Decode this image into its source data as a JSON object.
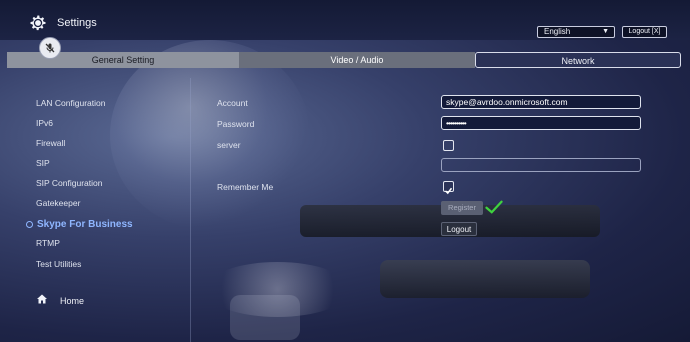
{
  "header": {
    "title": "Settings",
    "language_selected": "English",
    "logout_label": "Logout [X]"
  },
  "tabs": [
    {
      "label": "General Setting"
    },
    {
      "label": "Video / Audio"
    },
    {
      "label": "Network"
    }
  ],
  "sidebar": {
    "items": [
      {
        "label": "LAN Configuration"
      },
      {
        "label": "IPv6"
      },
      {
        "label": "Firewall"
      },
      {
        "label": "SIP"
      },
      {
        "label": "SIP Configuration"
      },
      {
        "label": "Gatekeeper"
      },
      {
        "label": "Skype For Business"
      },
      {
        "label": "RTMP"
      },
      {
        "label": "Test Utilities"
      }
    ],
    "home_label": "Home"
  },
  "form": {
    "account_label": "Account",
    "account_value": "skype@avrdoo.onmicrosoft.com",
    "password_label": "Password",
    "password_value": "••••••••••",
    "server_label": "server",
    "server_value": "",
    "remember_label": "Remember Me",
    "register_label": "Register",
    "logout_label": "Logout"
  },
  "icons": {
    "settings": "gear-icon",
    "mic_muted": "mic-muted-icon",
    "home": "home-icon",
    "registered": "checkmark-icon"
  },
  "colors": {
    "active_item": "#8fb6ff",
    "register_success": "#3fd33f"
  }
}
